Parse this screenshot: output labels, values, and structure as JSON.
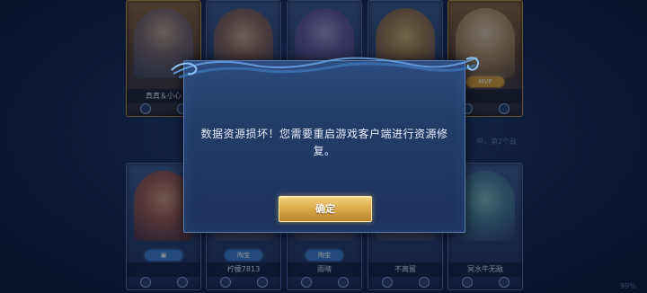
{
  "dialog": {
    "message": "数据资源损坏！您需要重启游戏客户端进行资源修复。",
    "confirm_label": "确定"
  },
  "background": {
    "top_cards": [
      {
        "player_name": "真真＆小心",
        "badge": ""
      },
      {
        "player_name": "",
        "badge": ""
      },
      {
        "player_name": "",
        "badge": ""
      },
      {
        "player_name": "",
        "badge": ""
      },
      {
        "player_name": "",
        "badge": "MVP"
      }
    ],
    "bottom_cards": [
      {
        "player_name": "",
        "badge": ""
      },
      {
        "player_name": "柠檬7813",
        "badge": "陶宝"
      },
      {
        "player_name": "雨晴",
        "badge": "陶宝"
      },
      {
        "player_name": "不离留",
        "badge": ""
      },
      {
        "player_name": "冥水牛无敌",
        "badge": ""
      }
    ],
    "right_side_text": "中，第2个敌",
    "bottom_right_text": "99%"
  },
  "colors": {
    "confirm_gold": "#d9a94a",
    "dialog_blue": "#223c68"
  }
}
